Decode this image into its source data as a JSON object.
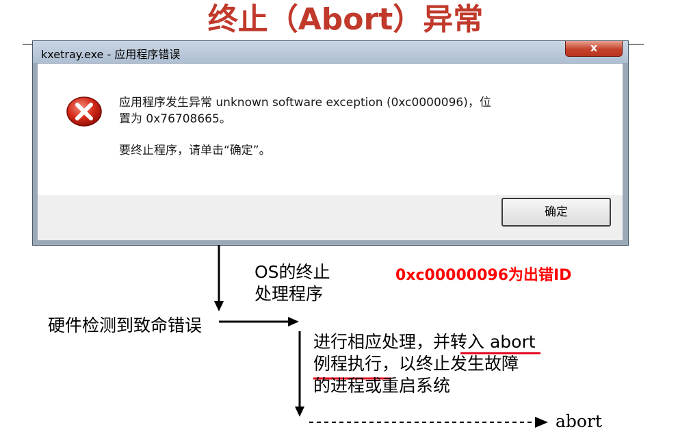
{
  "title": "终止（Abort）异常",
  "colors": {
    "title": "#c0392b",
    "annotation": "#ff0000",
    "underline": "#e3001b"
  },
  "dialog": {
    "window_title": "kxetray.exe - 应用程序错误",
    "close_symbol": "x",
    "icon": "error-x-icon",
    "message_line1": "应用程序发生异常 unknown software exception (0xc0000096)，位",
    "message_line2": "置为 0x76708665。",
    "instruction": "要终止程序，请单击“确定”。",
    "ok_label": "确定"
  },
  "diagram": {
    "os_handler_line1": "OS的终止",
    "os_handler_line2": "处理程序",
    "error_id_note": "0xc00000096为出错ID",
    "hardware_label": "硬件检测到致命错误",
    "process_line1_a": "进行相应处理，并",
    "process_line1_b": "转入 abort",
    "process_line2_a": "例程执行",
    "process_line2_b": "，以终止发生故障",
    "process_line3": "的进程或重启系统",
    "end_label": "abort"
  }
}
